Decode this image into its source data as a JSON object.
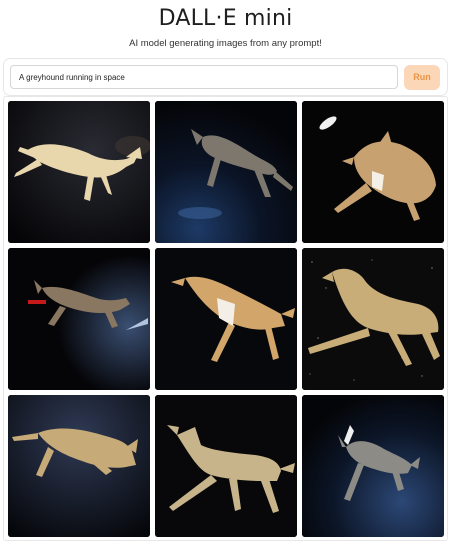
{
  "header": {
    "title": "DALL·E mini",
    "subtitle": "AI model generating images from any prompt!"
  },
  "prompt": {
    "value": "A greyhound running in space",
    "run_label": "Run"
  },
  "gallery": {
    "images": [
      {
        "subject": "greyhound-leaping",
        "dog_color": "#e8d6ad"
      },
      {
        "subject": "greyhound-running",
        "dog_color": "#7e776e"
      },
      {
        "subject": "greyhound-stretched",
        "dog_color": "#c8a171"
      },
      {
        "subject": "greyhound-in-orbit",
        "dog_color": "#8a7762"
      },
      {
        "subject": "greyhound-leaping",
        "dog_color": "#d2a56b"
      },
      {
        "subject": "greyhound-running",
        "dog_color": "#c9ad78"
      },
      {
        "subject": "greyhound-running",
        "dog_color": "#c6aa78"
      },
      {
        "subject": "greyhound-standing",
        "dog_color": "#c8b48a"
      },
      {
        "subject": "greyhound-running",
        "dog_color": "#8d8b86"
      }
    ]
  }
}
